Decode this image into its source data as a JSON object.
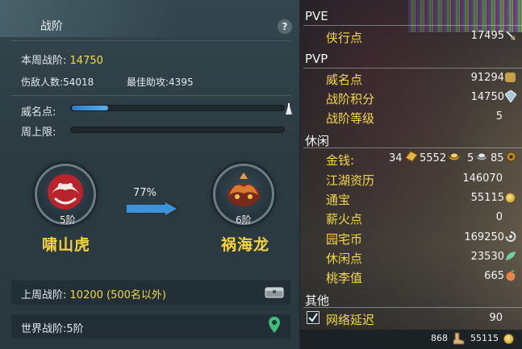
{
  "left": {
    "title": "战阶",
    "help": "?",
    "week_rank_label": "本周战阶:",
    "week_rank_value": "14750",
    "kills_label": "伤敌人数:",
    "kills_value": "54018",
    "assist_label": "最佳助攻:",
    "assist_value": "4395",
    "prestige_label": "威名点:",
    "prestige_progress": 0.17,
    "week_cap_label": "周上限:",
    "week_cap_progress": 0,
    "current_rank": {
      "level": "5阶",
      "name": "啸山虎"
    },
    "next_rank": {
      "level": "6阶",
      "name": "祸海龙"
    },
    "progress_percent": "77%",
    "last_week_label": "上周战阶:",
    "last_week_value": "10200 (500名以外)",
    "world_rank_label": "世界战阶:",
    "world_rank_value": "5阶"
  },
  "right": {
    "pve": {
      "title": "PVE",
      "rows": [
        {
          "label": "侠行点",
          "value": "17495"
        }
      ]
    },
    "pvp": {
      "title": "PVP",
      "rows": [
        {
          "label": "威名点",
          "value": "91294"
        },
        {
          "label": "战阶积分",
          "value": "14750"
        },
        {
          "label": "战阶等级",
          "value": "5"
        }
      ]
    },
    "leisure": {
      "title": "休闲",
      "money_label": "金钱:",
      "money": {
        "gold_brick": "34",
        "gold": "5552",
        "silver": "5",
        "copper": "85"
      },
      "rows": [
        {
          "label": "江湖资历",
          "value": "146070"
        },
        {
          "label": "通宝",
          "value": "55115"
        },
        {
          "label": "薪火点",
          "value": "0"
        },
        {
          "label": "园宅币",
          "value": "169250"
        },
        {
          "label": "休闲点",
          "value": "23530"
        },
        {
          "label": "桃李值",
          "value": "665"
        }
      ]
    },
    "other": {
      "title": "其他",
      "rows": [
        {
          "label": "网络延迟",
          "value": "90",
          "checked": true
        }
      ]
    },
    "footer": {
      "value1": "868",
      "value2": "55115"
    }
  },
  "colors": {
    "accent_yellow": "#f2d94a",
    "bar_blue": "#3a93dc",
    "panel": "#2e3d44"
  }
}
